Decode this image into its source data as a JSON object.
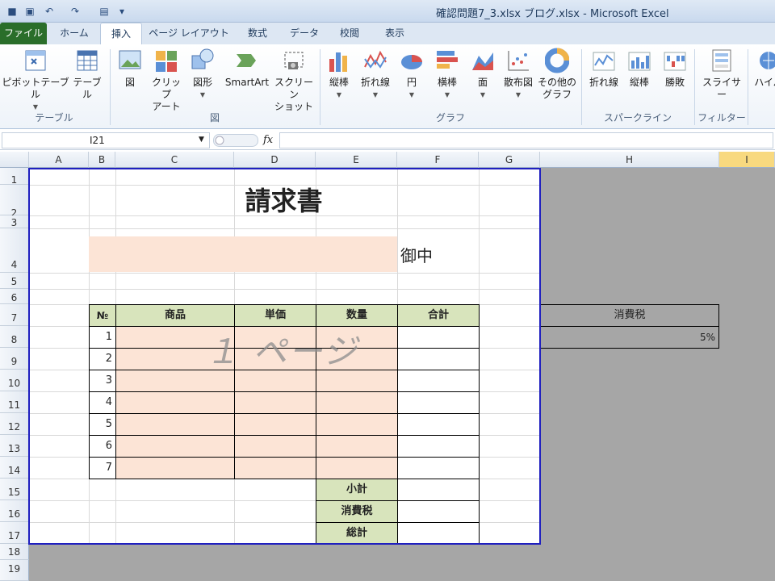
{
  "title_bar": {
    "title": "確認問題7_3.xlsx  ブログ.xlsx  -  Microsoft Excel"
  },
  "tabs": [
    "ファイル",
    "ホーム",
    "挿入",
    "ページ レイアウト",
    "数式",
    "データ",
    "校閲",
    "表示"
  ],
  "ribbon": {
    "table_group": {
      "label": "テーブル",
      "pivot": "ピボットテーブル",
      "table": "テーブル"
    },
    "illustrations_group": {
      "label": "図",
      "picture": "図",
      "clipart_1": "クリップ",
      "clipart_2": "アート",
      "shapes": "図形",
      "smartart": "SmartArt",
      "screenshot_1": "スクリーン",
      "screenshot_2": "ショット"
    },
    "chart_group": {
      "label": "グラフ",
      "column": "縦棒",
      "line": "折れ線",
      "pie": "円",
      "bar": "横棒",
      "area": "面",
      "scatter": "散布図",
      "other_1": "その他の",
      "other_2": "グラフ"
    },
    "sparkline_group": {
      "label": "スパークライン",
      "line": "折れ線",
      "column": "縦棒",
      "winloss": "勝敗"
    },
    "filter_group": {
      "label": "フィルター",
      "slicer": "スライサー"
    },
    "links_group": {
      "hyperlink": "ハイパ"
    }
  },
  "formula_bar": {
    "name_box": "I21",
    "fx": "fx",
    "formula": ""
  },
  "grid": {
    "columns": [
      "A",
      "B",
      "C",
      "D",
      "E",
      "F",
      "G",
      "H",
      "I"
    ],
    "selected_column": "I",
    "rows": [
      "1",
      "2",
      "3",
      "4",
      "5",
      "6",
      "7",
      "8",
      "9",
      "10",
      "11",
      "12",
      "13",
      "14",
      "15",
      "16",
      "17",
      "18",
      "19"
    ]
  },
  "sheet": {
    "title": "請求書",
    "recipient_suffix": "御中",
    "table_headers": {
      "no": "№",
      "product": "商品",
      "unit_price": "単価",
      "quantity": "数量",
      "total": "合計"
    },
    "item_numbers": [
      "1",
      "2",
      "3",
      "4",
      "5",
      "6",
      "7"
    ],
    "subtotal_label": "小計",
    "tax_label": "消費税",
    "grand_total_label": "総計",
    "tax_rate_header": "消費税",
    "tax_rate_value": "5%",
    "page_watermark": "１ ページ"
  },
  "colors": {
    "peach": "#fce4d6",
    "green": "#d8e4bc",
    "print_area_border": "#1f1fbf",
    "file_tab": "#2a6e2a"
  }
}
